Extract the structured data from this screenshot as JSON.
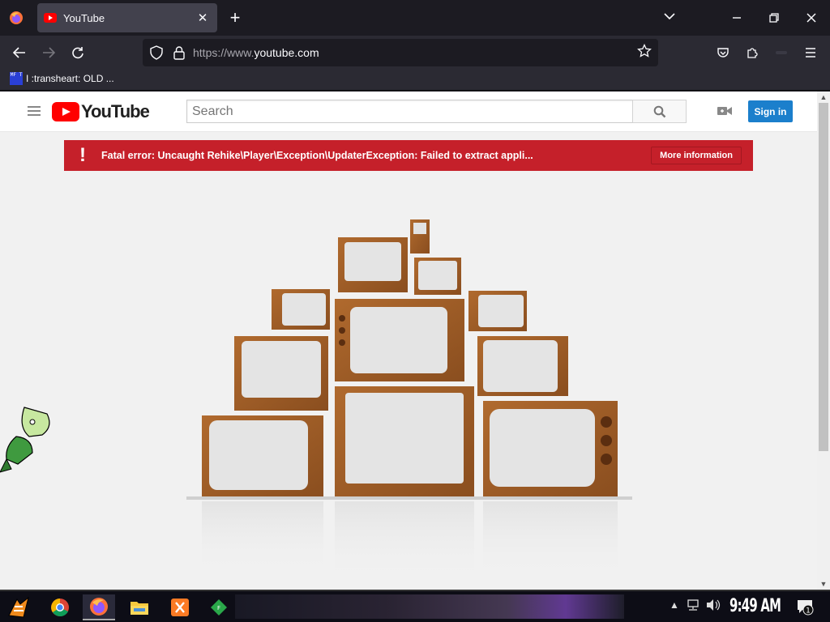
{
  "browser": {
    "tab": {
      "title": "YouTube",
      "close": "✕"
    },
    "new_tab": "+",
    "url_prefix": "https://www.",
    "url_domain": "youtube.com",
    "bookmark": {
      "icon_text": "MF T",
      "label": "I :transheart: OLD ..."
    }
  },
  "youtube": {
    "logo_text": "YouTube",
    "search_placeholder": "Search",
    "sign_in": "Sign in",
    "error": {
      "icon": "!",
      "message": "Fatal error: Uncaught Rehike\\Player\\Exception\\UpdaterException: Failed to extract appli...",
      "more": "More information"
    }
  },
  "taskbar": {
    "clock": "9:49 AM",
    "notification_count": "1"
  },
  "colors": {
    "tab_bg": "#42414d",
    "url_bg": "#1c1b22",
    "yt_red": "#ff0000",
    "error_red": "#c5202a",
    "signin_blue": "#1b7fcc"
  }
}
